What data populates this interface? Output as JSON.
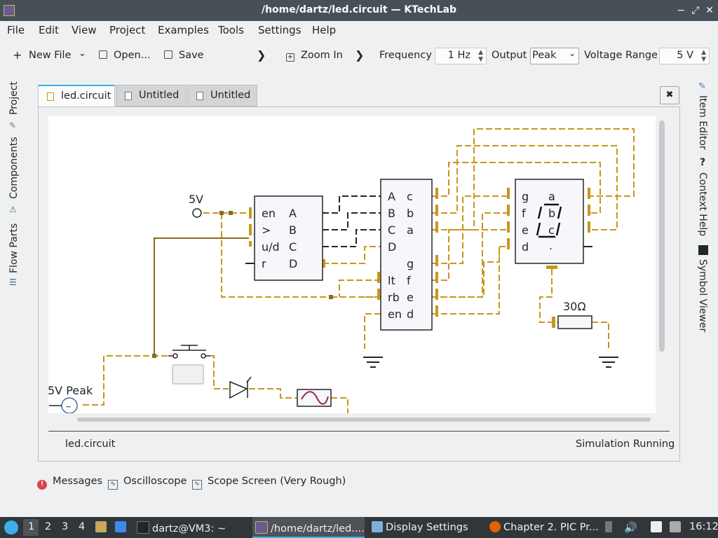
{
  "window": {
    "title": "/home/dartz/led.circuit — KTechLab"
  },
  "menubar": [
    "File",
    "Edit",
    "View",
    "Project",
    "Examples",
    "Tools",
    "Settings",
    "Help"
  ],
  "toolbar": {
    "new_file": "New File",
    "open": "Open...",
    "save": "Save",
    "zoom_in": "Zoom In",
    "frequency_label": "Frequency",
    "frequency_value": "1 Hz",
    "output_label": "Output",
    "output_value": "Peak",
    "voltage_label": "Voltage Range",
    "voltage_value": "5 V"
  },
  "left_dock": [
    "Project",
    "Components",
    "Flow Parts"
  ],
  "right_dock": [
    "Item Editor",
    "Context Help",
    "Symbol Viewer"
  ],
  "tabs": [
    "led.circuit",
    "Untitled",
    "Untitled"
  ],
  "circuit": {
    "supply_label": "5V",
    "source_label": "5V Peak",
    "resistor_label": "30Ω",
    "counter_pins_left": [
      "en",
      ">",
      "u/d",
      "r"
    ],
    "counter_pins_right": [
      "A",
      "B",
      "C",
      "D"
    ],
    "decoder_pins_left": [
      "A",
      "B",
      "C",
      "D",
      "lt",
      "rb",
      "en"
    ],
    "decoder_pins_right": [
      "c",
      "b",
      "a",
      "g",
      "f",
      "e",
      "d"
    ],
    "display_pins": [
      "g",
      "f",
      "e",
      "d"
    ],
    "display_segments": [
      "a",
      "b",
      "c",
      "."
    ]
  },
  "status": {
    "file": "led.circuit",
    "state": "Simulation Running"
  },
  "bottom_tabs": [
    "Messages",
    "Oscilloscope",
    "Scope Screen (Very Rough)"
  ],
  "taskbar": {
    "workspaces": [
      "1",
      "2",
      "3",
      "4"
    ],
    "items": [
      "dartz@VM3: ~",
      "/home/dartz/led....",
      "Display Settings",
      "Chapter 2. PIC Pr..."
    ],
    "clock": "16:12"
  },
  "colors": {
    "wire": "#c8961e",
    "wire_dark": "#8b6a1e",
    "titlebar": "#475057",
    "taskbar": "#31363b"
  }
}
